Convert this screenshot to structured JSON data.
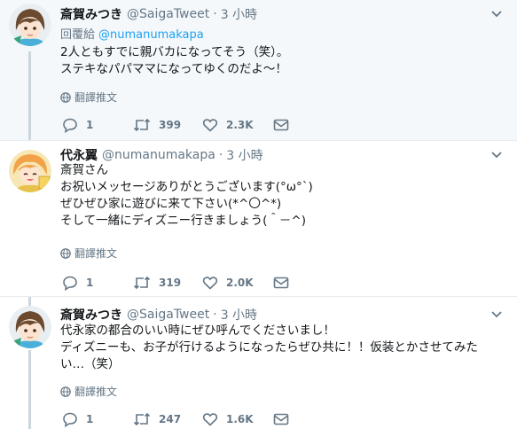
{
  "tweets": [
    {
      "name": "斎賀みつき",
      "handle": "@SaigaTweet",
      "dot": "·",
      "time": "3 小時",
      "reply_prefix": "回覆給",
      "reply_to": "@numanumakapa",
      "text": "2人ともすでに親バカになってそう（笑）。\nステキなパパママになってゆくのだよ〜！",
      "translate_label": "翻譯推文",
      "replies": "1",
      "retweets": "399",
      "likes": "2.3K"
    },
    {
      "name": "代永翼",
      "handle": "@numanumakapa",
      "dot": "·",
      "time": "3 小時",
      "text": "斎賀さん\nお祝いメッセージありがとうございます(°ω°ˋ)\nぜひぜひ家に遊びに来て下さい(*^〇^*)\nそして一緒にディズニー行きましょう(＾－^)",
      "translate_label": "翻譯推文",
      "replies": "1",
      "retweets": "319",
      "likes": "2.0K"
    },
    {
      "name": "斎賀みつき",
      "handle": "@SaigaTweet",
      "dot": "·",
      "time": "3 小時",
      "text": "代永家の都合のいい時にぜひ呼んでくださいまし！\nディズニーも、お子が行けるようになったらぜひ共に！！仮装とかさせてみた\nい…（笑）",
      "translate_label": "翻譯推文",
      "replies": "1",
      "retweets": "247",
      "likes": "1.6K"
    }
  ],
  "colors": {
    "accent": "#1da1f2",
    "muted": "#657786",
    "highlight_bg": "#f5f8fa",
    "thread_line": "#ccd6dd"
  },
  "icons": [
    "chevron-down-icon",
    "globe-icon",
    "reply-icon",
    "retweet-icon",
    "heart-icon",
    "envelope-icon"
  ]
}
